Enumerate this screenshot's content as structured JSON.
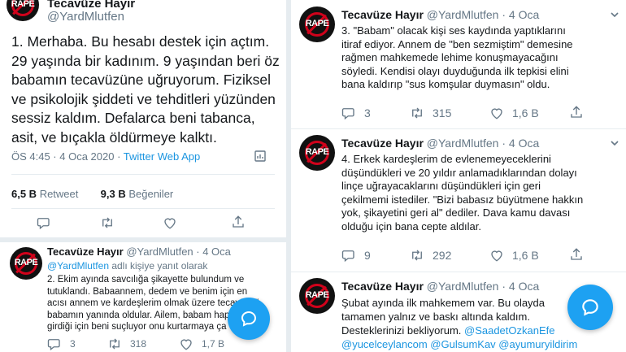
{
  "left": {
    "header": {
      "name": "Tecavüze Hayır",
      "handle": "@YardMlutfen",
      "avatar_text": "RAPE"
    },
    "main_tweet": {
      "lines": [
        "1.  Merhaba. Bu hesabı destek için açtım.",
        "29 yaşında bir kadınım. 9 yaşından beri öz",
        "babamın tecavüzüne uğruyorum. Fiziksel",
        "ve psikolojik şiddeti ve tehditleri yüzünden",
        "sessiz kaldım. Defalarca beni tabanca,",
        "asit, ve bıçakla öldürmeye kalktı."
      ],
      "time": "ÖS 4:45 · 4 Oca 2020 · ",
      "source": "Twitter Web App",
      "retweet_count": "6,5 B",
      "retweet_label": " Retweet",
      "like_count": "9,3 B",
      "like_label": " Beğeniler"
    },
    "reply_tweet": {
      "name": "Tecavüze Hayır",
      "handle": "@YardMlutfen · 4 Oca",
      "reply_to_handle": "@YardMlutfen",
      "reply_to_suffix": " adlı kişiye yanıt olarak",
      "lines": [
        "2. Ekim ayında savcılığa şikayette bulundum ve",
        "tutuklandı. Babaannem, dedem ve benim için en",
        "acısı annem ve kardeşlerim olmak üzere tecavüzcü",
        "babamın yanında oldular. Ailem, babam hapse",
        "girdiği için beni suçluyor onu kurtarmaya ça"
      ],
      "replies": "3",
      "retweets": "318",
      "likes": "1,7 B"
    }
  },
  "right": {
    "tweets": [
      {
        "name": "Tecavüze Hayır",
        "handle": "@YardMlutfen · 4 Oca",
        "lines": [
          "3. \"Babam\" olacak kişi ses kaydında yaptıklarını",
          "itiraf ediyor. Annem de \"ben sezmiştim\" demesine",
          "rağmen mahkemede lehime konuşmayacağını",
          "söyledi. Kendisi olayı duyduğunda ilk tepkisi elini",
          "bana kaldırıp \"sus komşular duymasın\" oldu."
        ],
        "replies": "3",
        "retweets": "315",
        "likes": "1,6 B"
      },
      {
        "name": "Tecavüze Hayır",
        "handle": "@YardMlutfen · 4 Oca",
        "lines": [
          "4. Erkek kardeşlerim de evlenemeyeceklerini",
          "düşündükleri ve 20 yıldır anlamadıklarından dolayı",
          "linçe uğrayacaklarını düşündükleri için geri",
          "çekilmemi istediler. \"Bizi babasız büyütmene hakkın",
          "yok, şikayetini geri al\" dediler. Dava kamu davası",
          "olduğu için bana cepte aldılar."
        ],
        "replies": "9",
        "retweets": "292",
        "likes": "1,6 B"
      },
      {
        "name": "Tecavüze Hayır",
        "handle": "@YardMlutfen · 4 Oca",
        "lines": [
          "Şubat ayında ilk mahkemem var. Bu olayda",
          "tamamen yalnız ve baskı altında kaldım.",
          "Desteklerinizi bekliyorum. "
        ],
        "mention": "@SaadetOzkanEfe",
        "last_line": "@yucelceylancom @GulsumKav @ayumuryildirim"
      }
    ]
  },
  "colors": {
    "accent": "#1da1f2",
    "link": "#1b95e0",
    "muted": "#657786",
    "avatar_mark": "#d0021b"
  },
  "icons": [
    "reply-icon",
    "retweet-icon",
    "like-icon",
    "share-icon",
    "compose-message-icon",
    "analytics-icon"
  ]
}
